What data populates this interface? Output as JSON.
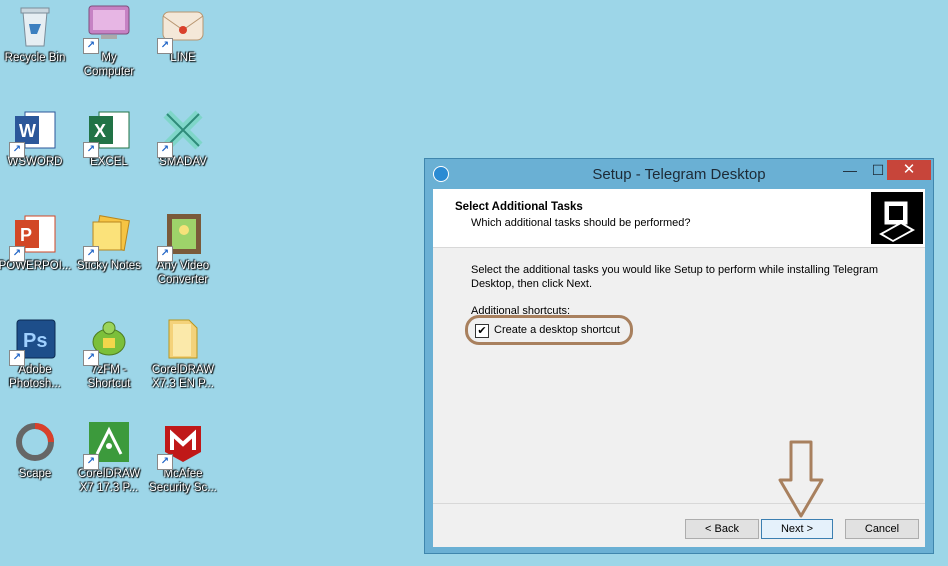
{
  "desktop": {
    "icons": [
      {
        "label": "Recycle Bin"
      },
      {
        "label": "My\nComputer"
      },
      {
        "label": "LINE"
      },
      {
        "label": "WSWORD"
      },
      {
        "label": "EXCEL"
      },
      {
        "label": "SMADAV"
      },
      {
        "label": "POWERPOI..."
      },
      {
        "label": "Sticky Notes"
      },
      {
        "label": "Any Video\nConverter"
      },
      {
        "label": "Adobe\nPhotosh..."
      },
      {
        "label": "7zFM -\nShortcut"
      },
      {
        "label": "CorelDRAW\nX7.3 EN P..."
      },
      {
        "label": "Scape"
      },
      {
        "label": "CorelDRAW\nX7 17.3 P..."
      },
      {
        "label": "McAfee\nSecurity Sc..."
      }
    ]
  },
  "dialog": {
    "title": "Setup - Telegram Desktop",
    "minimize": "—",
    "maximize": "☐",
    "close": "✕",
    "header_title": "Select Additional Tasks",
    "header_subtitle": "Which additional tasks should be performed?",
    "intro": "Select the additional tasks you would like Setup to perform while installing Telegram Desktop, then click Next.",
    "shortcuts_label": "Additional shortcuts:",
    "checkbox_label": "Create a desktop shortcut",
    "checkbox_checked": true,
    "checkmark": "✔",
    "back_label": "< Back",
    "next_label": "Next >",
    "cancel_label": "Cancel"
  }
}
